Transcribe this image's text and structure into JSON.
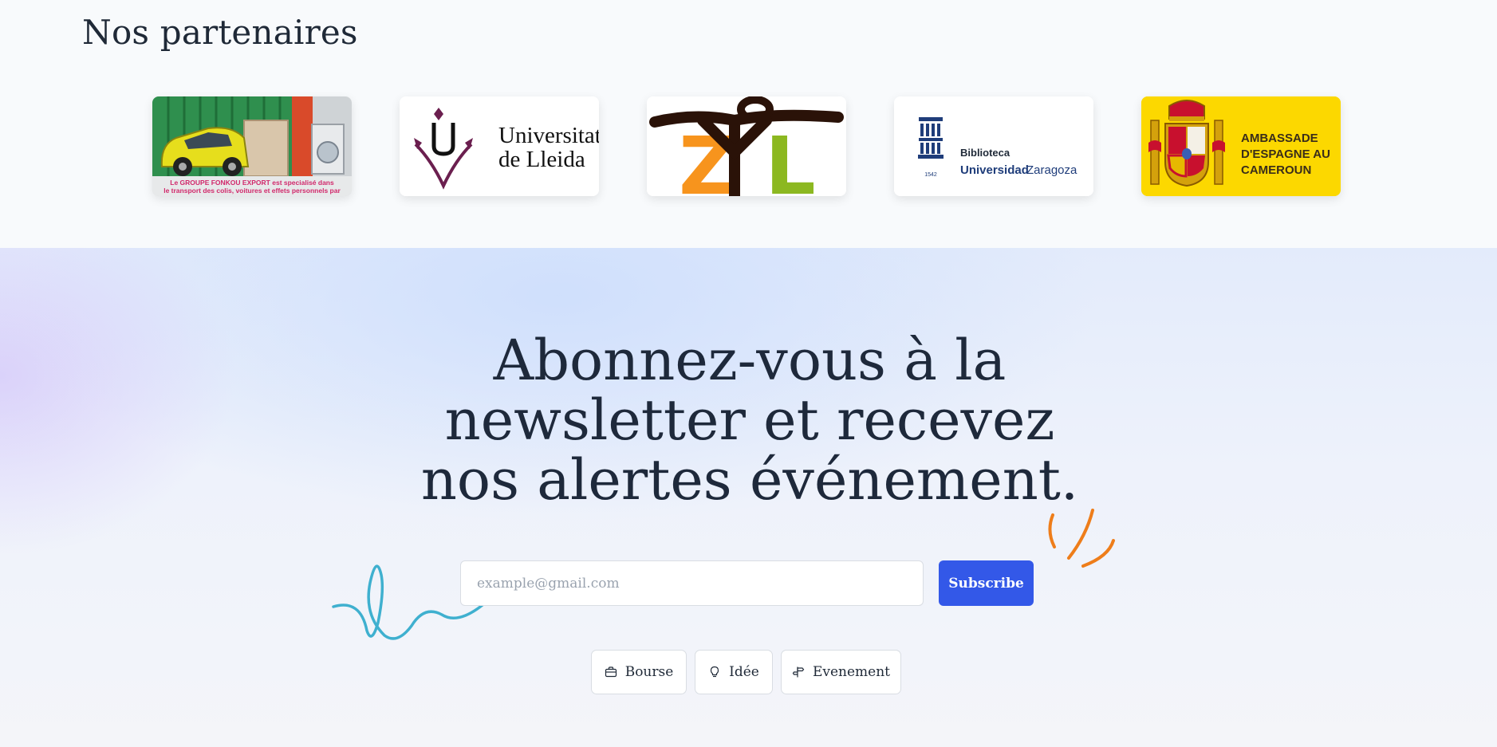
{
  "partners": {
    "title": "Nos partenaires",
    "logos": [
      {
        "name": "Groupe Fonkou Export",
        "caption_line1": "Le GROUPE FONKOU EXPORT est specialisé dans",
        "caption_line2": "le transport des colis, voitures et effets personnels par"
      },
      {
        "name": "Universitat de Lleida",
        "line1": "Universitat",
        "line2": "de Lleida"
      },
      {
        "name": "ZYL",
        "letters": [
          "Z",
          "Y",
          "L"
        ]
      },
      {
        "name": "Biblioteca Universidad Zaragoza",
        "line1": "Biblioteca",
        "line2a": "Universidad",
        "line2b": "Zaragoza",
        "year": "1542"
      },
      {
        "name": "Ambassade d'Espagne au Cameroun",
        "line1": "AMBASSADE",
        "line2": "D'ESPAGNE AU",
        "line3": "CAMEROUN"
      }
    ]
  },
  "newsletter": {
    "headline_line1": "Abonnez-vous à la",
    "headline_line2": "newsletter et recevez",
    "headline_line3": "nos alertes événement.",
    "email_placeholder": "example@gmail.com",
    "subscribe_label": "Subscribe",
    "tags": [
      {
        "label": "Bourse",
        "icon": "briefcase-icon"
      },
      {
        "label": "Idée",
        "icon": "lightbulb-icon"
      },
      {
        "label": "Evenement",
        "icon": "signpost-icon"
      }
    ]
  },
  "colors": {
    "primary": "#3358e8",
    "heading": "#1e293b",
    "squiggle_blue": "#3fb0cf",
    "squiggle_orange": "#ee7d1a",
    "embassy_yellow": "#fcd800"
  }
}
